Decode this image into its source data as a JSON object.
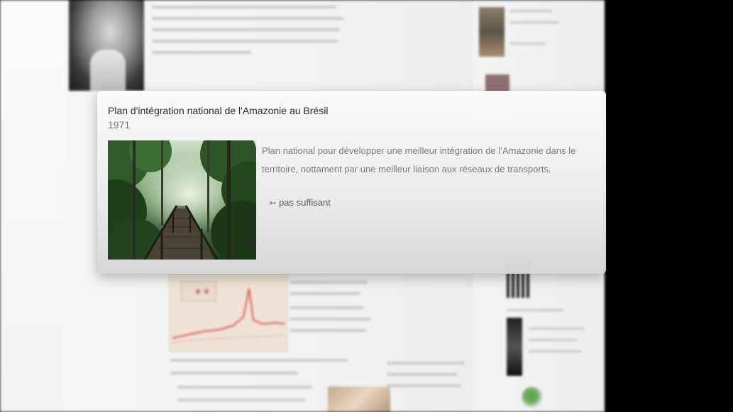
{
  "popup": {
    "title": "Plan d'intégration national de l'Amazonie au Brésil",
    "year": "1971",
    "image_icon": "forest-boardwalk-photo",
    "description": "Plan national pour développer une meilleur intégration de l’Amazonie dans le territoire, nottament par une meilleur liaison aux réseaux de transports.",
    "link_icon": "arrow-right-icon",
    "link_label": "pas suffisant"
  },
  "colors": {
    "popup_title": "#2b2b2b",
    "popup_text": "#7b7b7b",
    "background_right": "#000000"
  }
}
